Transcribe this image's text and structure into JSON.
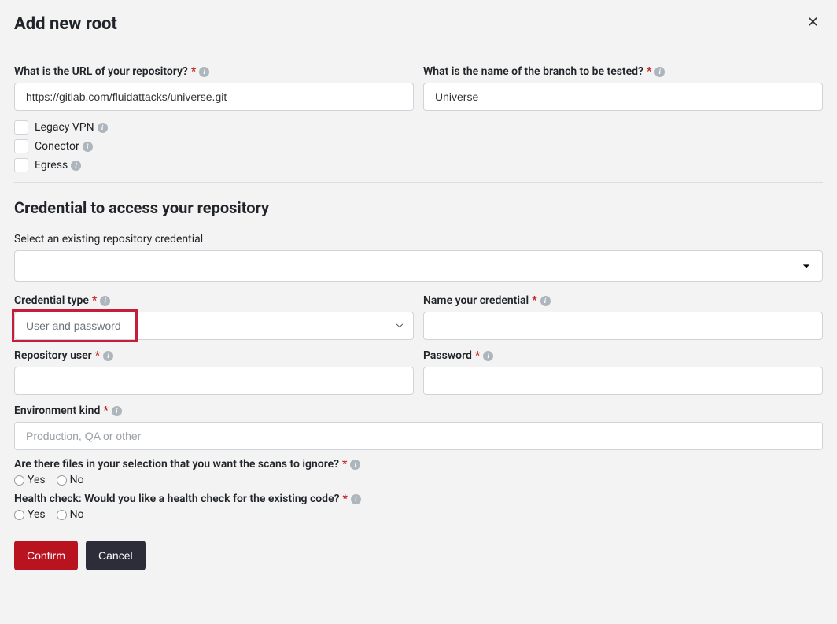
{
  "header": {
    "title": "Add new root"
  },
  "fields": {
    "url": {
      "label": "What is the URL of your repository?",
      "value": "https://gitlab.com/fluidattacks/universe.git"
    },
    "branch": {
      "label": "What is the name of the branch to be tested?",
      "value": "Universe"
    },
    "legacy_vpn": {
      "label": "Legacy VPN"
    },
    "conector": {
      "label": "Conector"
    },
    "egress": {
      "label": "Egress"
    },
    "credential_section_title": "Credential to access your repository",
    "existing_credential": {
      "label": "Select an existing repository credential"
    },
    "credential_type": {
      "label": "Credential type",
      "value": "User and password"
    },
    "credential_name": {
      "label": "Name your credential"
    },
    "repo_user": {
      "label": "Repository user"
    },
    "password": {
      "label": "Password"
    },
    "environment_kind": {
      "label": "Environment kind",
      "placeholder": "Production, QA or other"
    },
    "ignore_files": {
      "label": "Are there files in your selection that you want the scans to ignore?"
    },
    "health_check": {
      "label": "Health check: Would you like a health check for the existing code?"
    },
    "radio": {
      "yes": "Yes",
      "no": "No"
    }
  },
  "buttons": {
    "confirm": "Confirm",
    "cancel": "Cancel"
  }
}
